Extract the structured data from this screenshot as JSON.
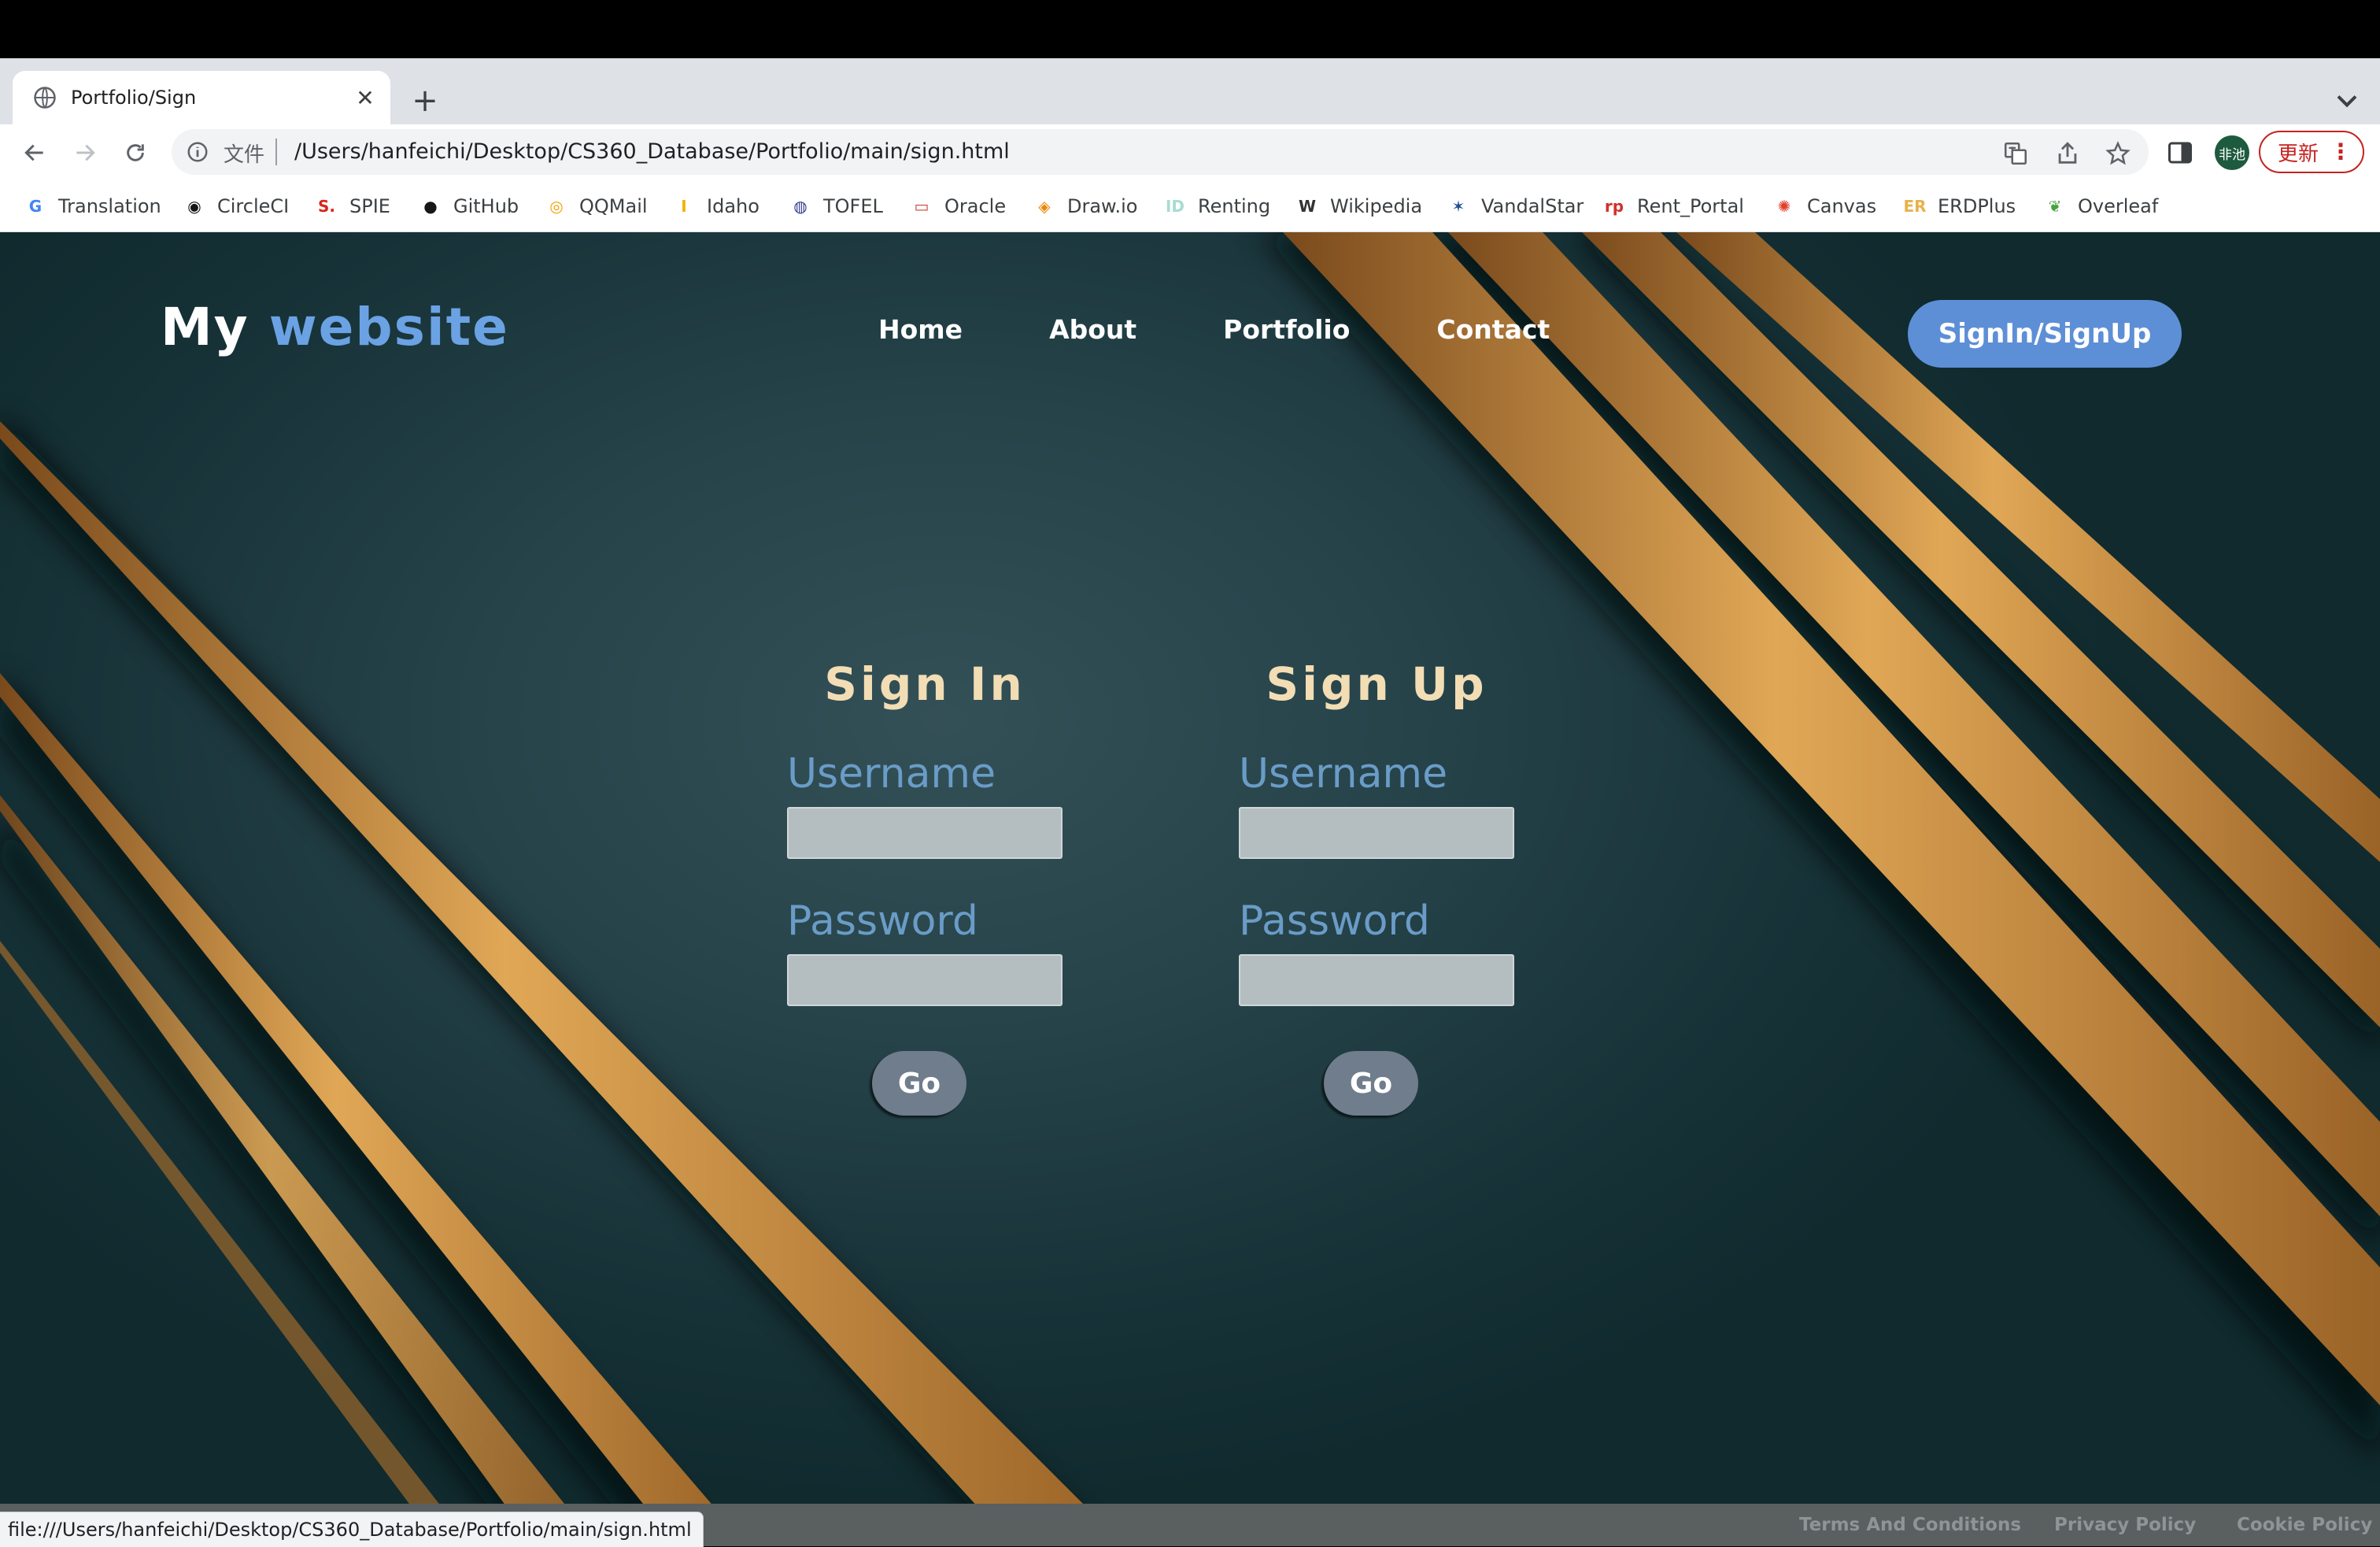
{
  "browser": {
    "tab": {
      "title": "Portfolio/Sign",
      "close": "✕"
    },
    "new_tab": "+",
    "address": {
      "scheme_label": "文件",
      "url": "/Users/hanfeichi/Desktop/CS360_Database/Portfolio/main/sign.html"
    },
    "profile_label": "非池",
    "update_label": "更新",
    "bookmarks": [
      {
        "label": "Translation",
        "icon": "google-translate-icon",
        "glyph": "G",
        "color": "#4285f4"
      },
      {
        "label": "CircleCI",
        "icon": "circleci-icon",
        "glyph": "◉",
        "color": "#161616"
      },
      {
        "label": "SPIE",
        "icon": "spie-icon",
        "glyph": "S.",
        "color": "#d9261c"
      },
      {
        "label": "GitHub",
        "icon": "github-icon",
        "glyph": "●",
        "color": "#181717"
      },
      {
        "label": "QQMail",
        "icon": "qqmail-icon",
        "glyph": "◎",
        "color": "#f4a000"
      },
      {
        "label": "Idaho",
        "icon": "idaho-icon",
        "glyph": "I",
        "color": "#f1b300"
      },
      {
        "label": "TOFEL",
        "icon": "tofel-icon",
        "glyph": "◍",
        "color": "#2a3a8c"
      },
      {
        "label": "Oracle",
        "icon": "oracle-icon",
        "glyph": "▭",
        "color": "#c74634"
      },
      {
        "label": "Draw.io",
        "icon": "drawio-icon",
        "glyph": "◈",
        "color": "#f08705"
      },
      {
        "label": "Renting",
        "icon": "renting-icon",
        "glyph": "ID",
        "color": "#a8dcd0"
      },
      {
        "label": "Wikipedia",
        "icon": "wikipedia-icon",
        "glyph": "W",
        "color": "#333333"
      },
      {
        "label": "VandalStar",
        "icon": "vandalstar-icon",
        "glyph": "✶",
        "color": "#1f4e8c"
      },
      {
        "label": "Rent_Portal",
        "icon": "rent-portal-icon",
        "glyph": "rp",
        "color": "#d0312d"
      },
      {
        "label": "Canvas",
        "icon": "canvas-icon",
        "glyph": "✺",
        "color": "#e13f2b"
      },
      {
        "label": "ERDPlus",
        "icon": "erdplus-icon",
        "glyph": "ER",
        "color": "#e8b24a"
      },
      {
        "label": "Overleaf",
        "icon": "overleaf-icon",
        "glyph": "❦",
        "color": "#47a141"
      }
    ],
    "status_url": "file:///Users/hanfeichi/Desktop/CS360_Database/Portfolio/main/sign.html"
  },
  "page": {
    "logo": {
      "first": "My",
      "second": "website"
    },
    "nav": [
      "Home",
      "About",
      "Portfolio",
      "Contact"
    ],
    "signin_button": "SignIn/SignUp",
    "signin_form": {
      "title": "Sign In",
      "username_label": "Username",
      "password_label": "Password",
      "submit": "Go"
    },
    "signup_form": {
      "title": "Sign Up",
      "username_label": "Username",
      "password_label": "Password",
      "submit": "Go"
    },
    "footer": [
      "Terms And Conditions",
      "Privacy Policy",
      "Cookie Policy"
    ]
  },
  "colors": {
    "background": "#1f3a40",
    "accent_stripe": "#d39a4a",
    "logo_accent": "#6aa2e4",
    "heading": "#f2ddb4",
    "label": "#6a9cc7",
    "signin_button": "#5d8fd6",
    "go_button": "#6f7d8c"
  }
}
